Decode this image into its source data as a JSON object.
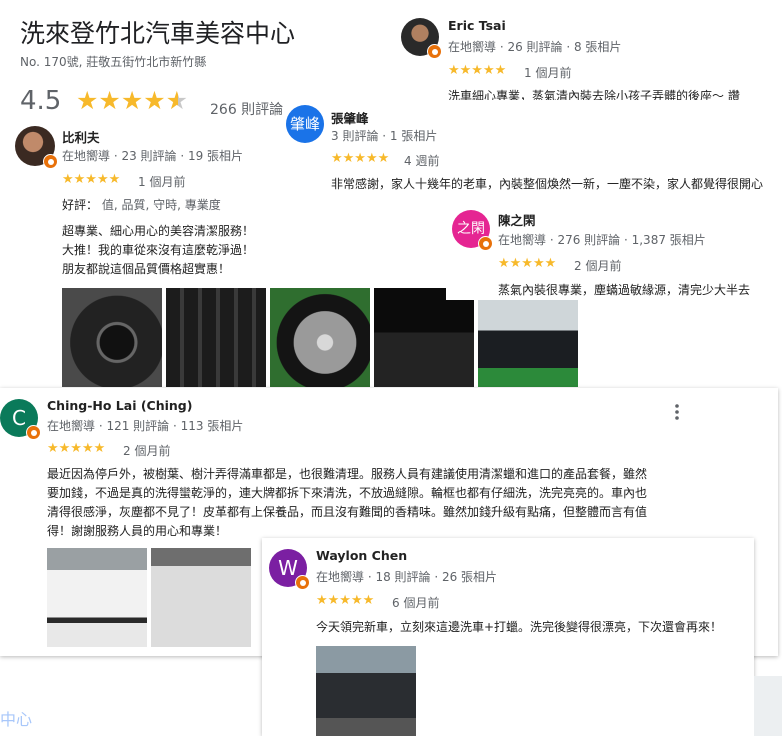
{
  "place": {
    "title": "洗來登竹北汽車美容中心",
    "address": "No. 170號, 莊敬五街竹北市新竹縣",
    "rating": "4.5",
    "stars": "★★★★★",
    "review_count": "266 則評論"
  },
  "reviews": {
    "eric": {
      "name": "Eric Tsai",
      "meta": "在地嚮導 · 26 則評論 · 8 張相片",
      "stars": "★★★★★",
      "when": "1 個月前",
      "text": "洗車細心專業，蒸氣清內裝去除小孩子弄髒的後座～ 讚"
    },
    "zhang": {
      "avatar_text": "肇峰",
      "name": "張肇峰",
      "meta": "3 則評論 · 1 張相片",
      "stars": "★★★★★",
      "when": "4 週前",
      "text": "非常感謝，家人十幾年的老車，內裝整個煥然一新，一塵不染，家人都覺得很開心"
    },
    "bili": {
      "name": "比利夫",
      "meta": "在地嚮導 · 23 則評論 · 19 張相片",
      "stars": "★★★★★",
      "when": "1 個月前",
      "good_label": "好評：",
      "good_text": "值, 品質, 守時, 專業度",
      "lines": [
        "超專業、細心用心的美容清潔服務！",
        "大推！我的車從來沒有這麼乾淨過！",
        "朋友都說這個品質價格超實惠！"
      ]
    },
    "chen": {
      "avatar_text": "之閑",
      "name": "陳之閑",
      "meta": "在地嚮導 · 276 則評論 · 1,387 張相片",
      "stars": "★★★★★",
      "when": "2 個月前",
      "text": "蒸氣內裝很專業，塵蟎過敏緣源，清完少大半去"
    },
    "ching": {
      "avatar_text": "C",
      "name": "Ching-Ho Lai (Ching)",
      "meta": "在地嚮導 · 121 則評論 · 113 張相片",
      "stars": "★★★★★",
      "when": "2 個月前",
      "lines": [
        "最近因為停戶外，被樹葉、樹汁弄得滿車都是，也很難清理。服務人員有建議使用清潔蠟和進口的產品套餐，雖然",
        "要加錢，不過是真的洗得蠻乾淨的，連大牌都拆下來清洗，不放過縫隙。輪框也都有仔細洗，洗完亮亮的。車內也",
        "清得很感淨，灰塵都不見了！皮革都有上保養品，而且沒有難聞的香精味。雖然加錢升級有點痛，但整體而言有值",
        "得！謝謝服務人員的用心和專業！"
      ]
    },
    "waylon": {
      "avatar_text": "W",
      "name": "Waylon Chen",
      "meta": "在地嚮導 · 18 則評論 · 26 張相片",
      "stars": "★★★★★",
      "when": "6 個月前",
      "text": "今天領完新車，立刻來這邊洗車+打蠟。洗完後變得很漂亮，下次還會再來！"
    }
  },
  "footer_partial": "中心",
  "more_icon": "more-vert-icon",
  "colors": {
    "star": "#f7b92b",
    "badge": "#e8710a",
    "zhang_avatar": "#1a73e8",
    "chen_avatar": "#e52592",
    "ching_avatar": "#0a7a5a",
    "waylon_avatar": "#7b1fa2"
  }
}
